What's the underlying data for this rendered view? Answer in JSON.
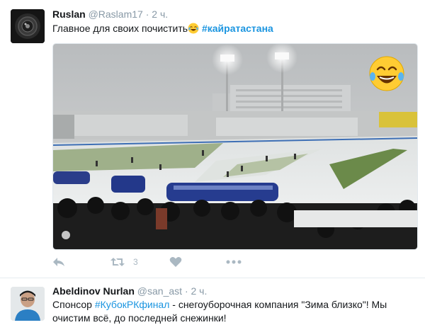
{
  "tweet1": {
    "name": "Ruslan",
    "handle": "@Raslam17",
    "separator": "·",
    "time": "2 ч.",
    "text": "Главное для своих почистить",
    "emoji": "laughing-tears-emoji",
    "hashtag": "#кайратастана",
    "actions": {
      "reply_icon": "reply-icon",
      "retweet_icon": "retweet-icon",
      "retweet_count": "3",
      "like_icon": "heart-icon",
      "more_icon": "more-dots-icon"
    }
  },
  "tweet2": {
    "name": "Abeldinov Nurlan",
    "handle": "@san_ast",
    "separator": "·",
    "time": "2 ч.",
    "text_part1": "Спонсор ",
    "hashtag": "#КубокРКфинал",
    "text_part2": " - снегоуборочная компания \"Зима близко\"! Мы",
    "text_line2": "очистим всё, до последней снежинки!"
  },
  "colors": {
    "link": "#1b95e0",
    "muted": "#8899a6",
    "action": "#aab8c2"
  }
}
